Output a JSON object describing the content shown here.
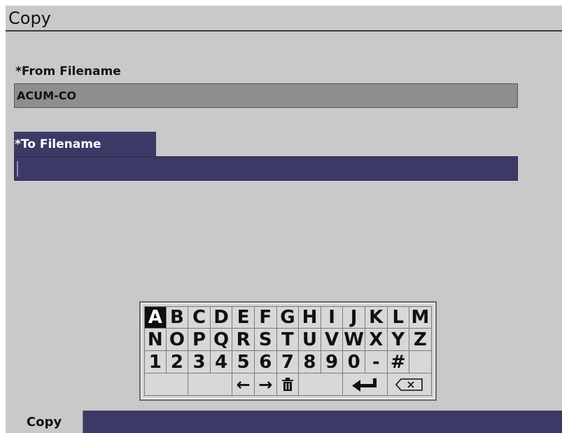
{
  "window": {
    "title": "Copy"
  },
  "from": {
    "label": "*From Filename",
    "value": "ACUM-CO"
  },
  "to": {
    "label": "*To Filename",
    "value": ""
  },
  "keyboard": {
    "rows": [
      [
        "A",
        "B",
        "C",
        "D",
        "E",
        "F",
        "G",
        "H",
        "I",
        "J",
        "K",
        "L",
        "M"
      ],
      [
        "N",
        "O",
        "P",
        "Q",
        "R",
        "S",
        "T",
        "U",
        "V",
        "W",
        "X",
        "Y",
        "Z"
      ],
      [
        "1",
        "2",
        "3",
        "4",
        "5",
        "6",
        "7",
        "8",
        "9",
        "0",
        "-",
        "#",
        ""
      ]
    ],
    "selected_key": "A",
    "left_arrow": "←",
    "right_arrow": "→",
    "delete_icon": "🗑",
    "enter_icon": "↵"
  },
  "footer": {
    "copy_label": "Copy"
  },
  "colors": {
    "accent": "#3b3a66",
    "panel": "#c9c9ca",
    "readonly_field": "#8e8e90"
  }
}
